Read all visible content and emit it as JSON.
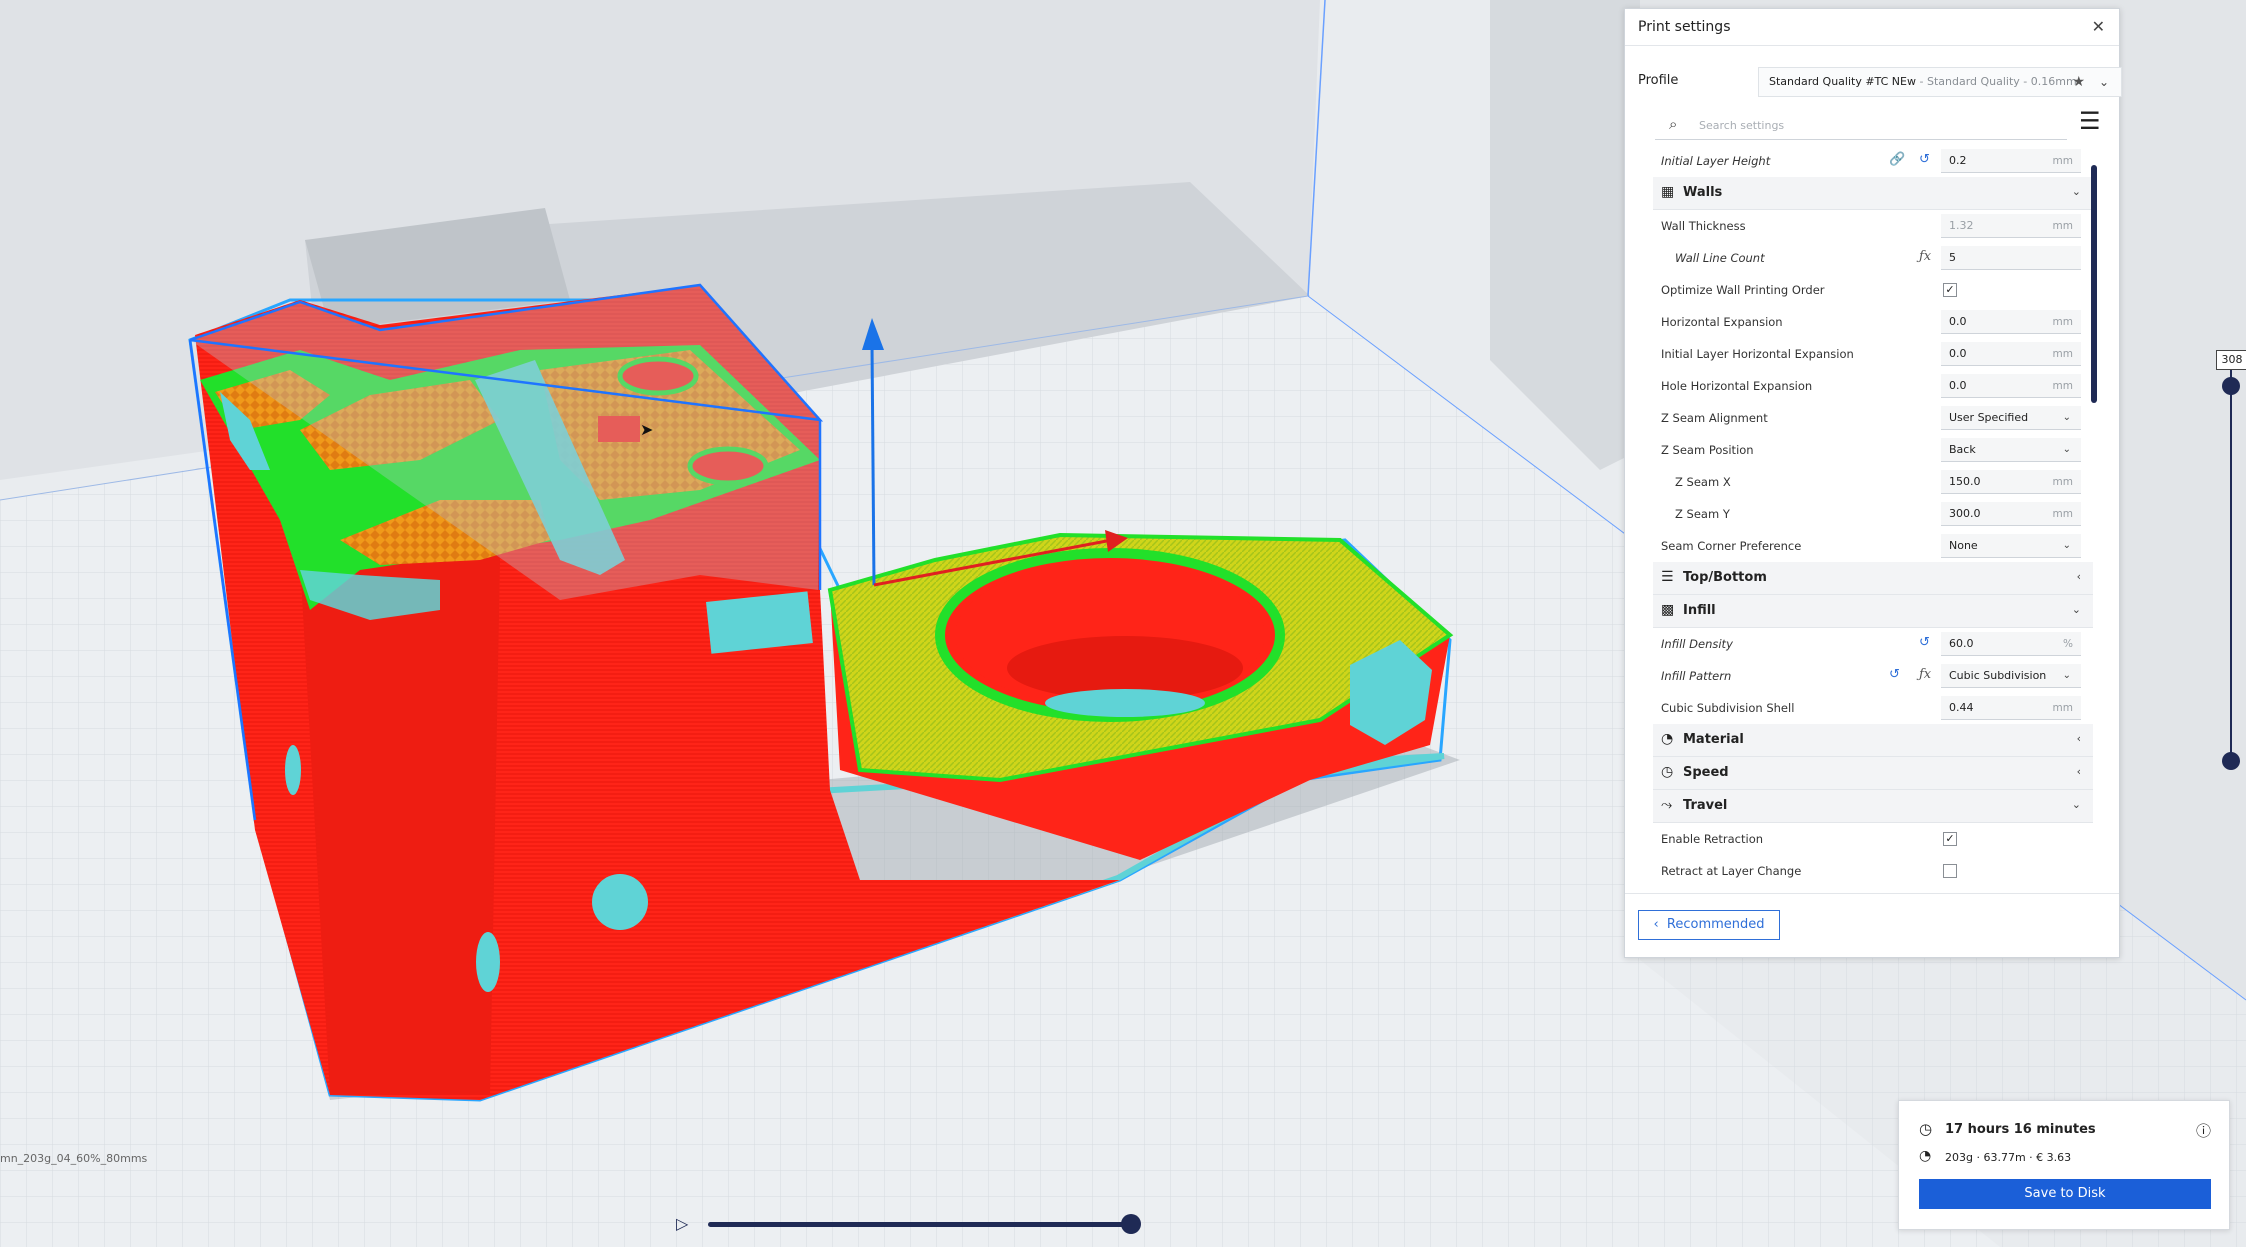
{
  "print_settings": {
    "title": "Print settings",
    "close_icon": "close-icon",
    "profile_label": "Profile",
    "profile_name": "Standard Quality #TC NEw",
    "profile_sub": " - Standard Quality - 0.16mm",
    "search_placeholder": "Search settings",
    "rows": [
      {
        "id": "initial_layer_height",
        "label": "Initial Layer Height",
        "value": "0.2",
        "unit": "mm"
      },
      {
        "id": "walls",
        "label": "Walls"
      },
      {
        "id": "wall_thickness",
        "label": "Wall Thickness",
        "value": "1.32",
        "unit": "mm"
      },
      {
        "id": "wall_line_count",
        "label": "Wall Line Count",
        "value": "5"
      },
      {
        "id": "optimize_wall",
        "label": "Optimize Wall Printing Order",
        "checked": "✓"
      },
      {
        "id": "horizontal_expansion",
        "label": "Horizontal Expansion",
        "value": "0.0",
        "unit": "mm"
      },
      {
        "id": "initial_layer_horizontal_expansion",
        "label": "Initial Layer Horizontal Expansion",
        "value": "0.0",
        "unit": "mm"
      },
      {
        "id": "hole_horizontal_expansion",
        "label": "Hole Horizontal Expansion",
        "value": "0.0",
        "unit": "mm"
      },
      {
        "id": "z_seam_alignment",
        "label": "Z Seam Alignment",
        "value": "User Specified"
      },
      {
        "id": "z_seam_position",
        "label": "Z Seam Position",
        "value": "Back"
      },
      {
        "id": "z_seam_x",
        "label": "Z Seam X",
        "value": "150.0",
        "unit": "mm"
      },
      {
        "id": "z_seam_y",
        "label": "Z Seam Y",
        "value": "300.0",
        "unit": "mm"
      },
      {
        "id": "seam_corner_preference",
        "label": "Seam Corner Preference",
        "value": "None"
      },
      {
        "id": "top_bottom",
        "label": "Top/Bottom"
      },
      {
        "id": "infill",
        "label": "Infill"
      },
      {
        "id": "infill_density",
        "label": "Infill Density",
        "value": "60.0",
        "unit": "%"
      },
      {
        "id": "infill_pattern",
        "label": "Infill Pattern",
        "value": "Cubic Subdivision"
      },
      {
        "id": "cubic_subdivision_shell",
        "label": "Cubic Subdivision Shell",
        "value": "0.44",
        "unit": "mm"
      },
      {
        "id": "material",
        "label": "Material"
      },
      {
        "id": "speed",
        "label": "Speed"
      },
      {
        "id": "travel",
        "label": "Travel"
      },
      {
        "id": "enable_retraction",
        "label": "Enable Retraction",
        "checked": "✓"
      },
      {
        "id": "retract_at_layer_change",
        "label": "Retract at Layer Change",
        "checked": ""
      }
    ],
    "recommended_label": "Recommended"
  },
  "estimate": {
    "time": "17 hours 16 minutes",
    "material": "203g · 63.77m · € 3.63",
    "save_label": "Save to Disk"
  },
  "layer_slider": {
    "max_layer": "308"
  },
  "filename": "mn_203g_04_60%_80mms",
  "colors": {
    "accent": "#1b5fd8",
    "wall_outer": "#ff2a1a",
    "wall_inner": "#22e02a",
    "infill": "#f09a1a",
    "skin": "#d7d51a",
    "support": "#5fd3d6",
    "dark_ui": "#1f2a55"
  }
}
